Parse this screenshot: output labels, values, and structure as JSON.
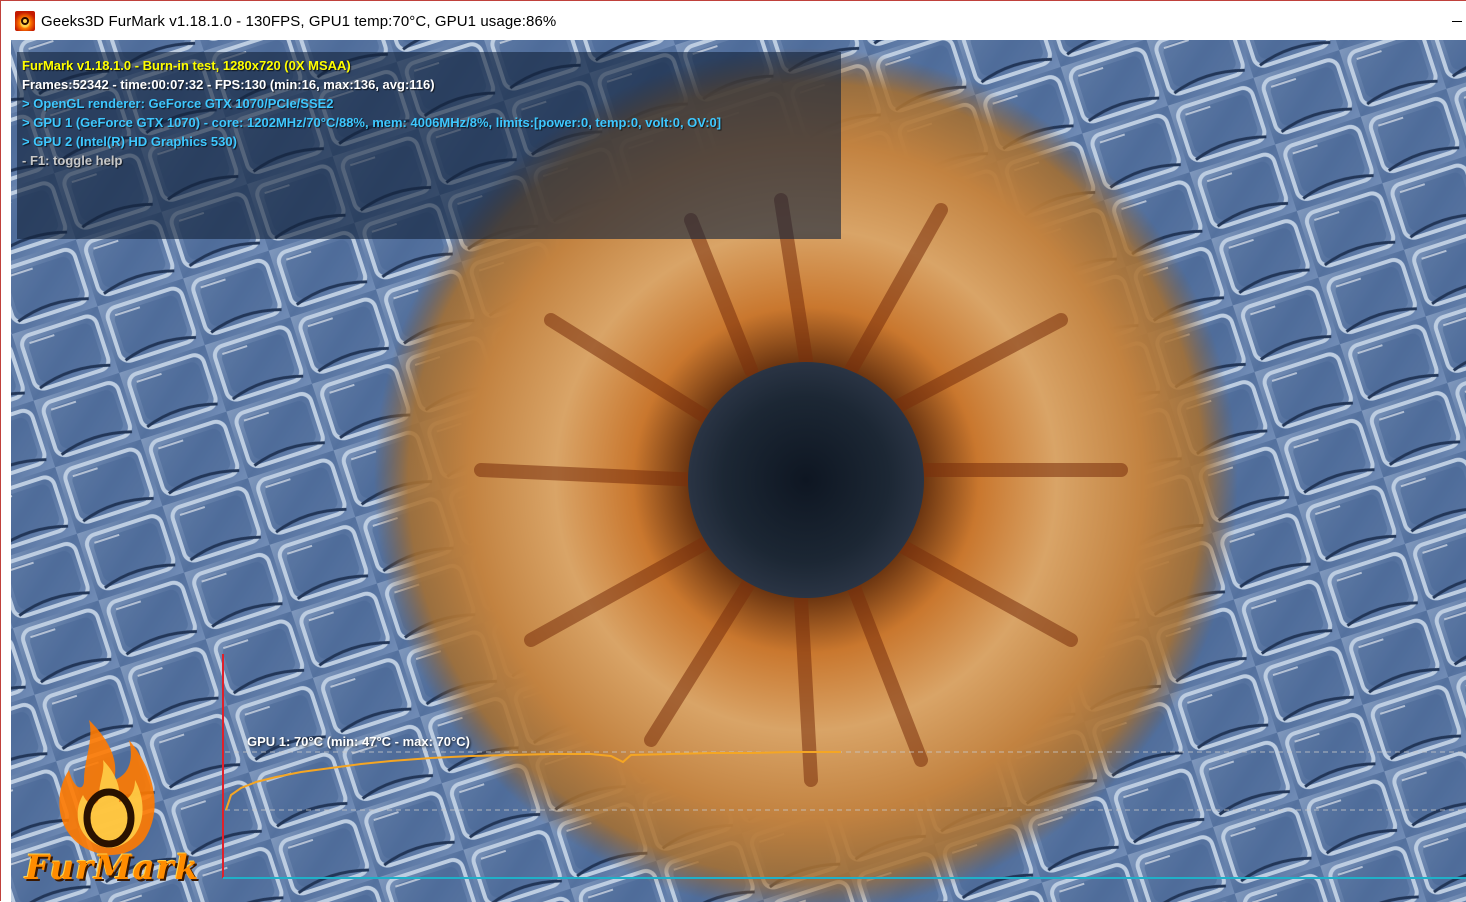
{
  "window": {
    "title": "Geeks3D FurMark v1.18.1.0 - 130FPS, GPU1 temp:70°C, GPU1 usage:86%",
    "icon": "furmark-icon"
  },
  "osd": {
    "line1": "FurMark v1.18.1.0 - Burn-in test, 1280x720 (0X MSAA)",
    "line2": "Frames:52342 - time:00:07:32 - FPS:130 (min:16, max:136, avg:116)",
    "line3": "> OpenGL renderer: GeForce GTX 1070/PCIe/SSE2",
    "line4": "> GPU 1 (GeForce GTX 1070) - core: 1202MHz/70°C/88%, mem: 4006MHz/8%, limits:[power:0, temp:0, volt:0, OV:0]",
    "line5": "> GPU 2 (Intel(R) HD Graphics 530)",
    "line6": "- F1: toggle help"
  },
  "graph": {
    "label": "GPU 1: 70°C (min: 47°C - max: 70°C)",
    "min_c": 47,
    "max_c": 70,
    "current_c": 70,
    "line_color": "#f5a623"
  },
  "logo": {
    "text": "FurMark"
  },
  "colors": {
    "osd_title": "#ffff00",
    "osd_stats": "#ffffff",
    "osd_gpu": "#3ec8ff",
    "osd_help": "#c8c8c8",
    "graph_axis_y": "#e0202a",
    "graph_axis_x": "#20b0c8"
  }
}
